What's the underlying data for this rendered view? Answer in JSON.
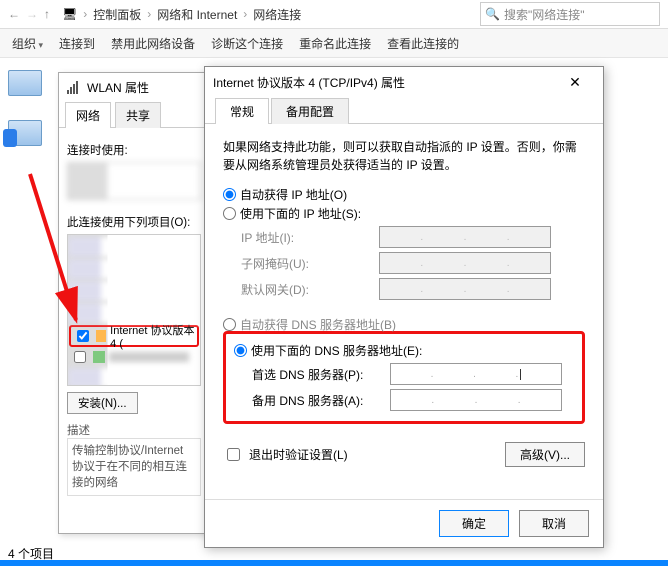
{
  "breadcrumb": {
    "root": "控制面板",
    "mid": "网络和 Internet",
    "leaf": "网络连接",
    "search_placeholder": "搜索\"网络连接\""
  },
  "toolbar": {
    "organize": "组织",
    "connect": "连接到",
    "disable": "禁用此网络设备",
    "diagnose": "诊断这个连接",
    "rename": "重命名此连接",
    "viewstatus": "查看此连接的"
  },
  "statusbar": {
    "count": "4 个项目"
  },
  "wlan": {
    "title": "WLAN 属性",
    "tab_network": "网络",
    "tab_share": "共享",
    "connect_using": "连接时使用:",
    "uses_items": "此连接使用下列项目(O):",
    "item_ipv4": "Internet 协议版本 4 (",
    "install_btn": "安装(N)...",
    "desc_label": "描述",
    "desc_text": "传输控制协议/Internet 协议于在不同的相互连接的网络"
  },
  "ipv4": {
    "title": "Internet 协议版本 4 (TCP/IPv4) 属性",
    "tab_general": "常规",
    "tab_alt": "备用配置",
    "help": "如果网络支持此功能，则可以获取自动指派的 IP 设置。否则，你需要从网络系统管理员处获得适当的 IP 设置。",
    "auto_ip": "自动获得 IP 地址(O)",
    "use_ip": "使用下面的 IP 地址(S):",
    "ip_label": "IP 地址(I):",
    "mask_label": "子网掩码(U):",
    "gw_label": "默认网关(D):",
    "auto_dns": "自动获得 DNS 服务器地址(B)",
    "use_dns": "使用下面的 DNS 服务器地址(E):",
    "dns1_label": "首选 DNS 服务器(P):",
    "dns2_label": "备用 DNS 服务器(A):",
    "exit_validate": "退出时验证设置(L)",
    "advanced": "高级(V)...",
    "ok": "确定",
    "cancel": "取消"
  }
}
